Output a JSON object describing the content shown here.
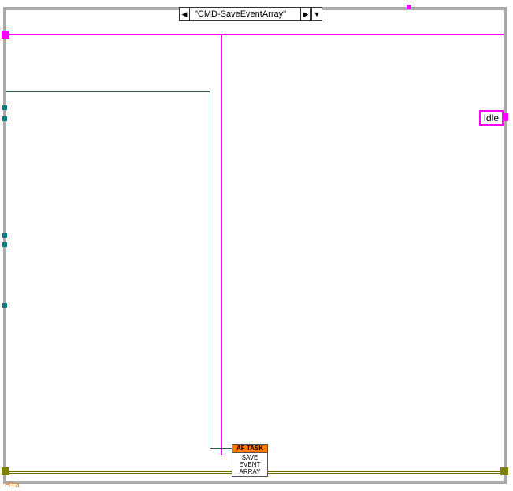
{
  "case": {
    "selector_text": "\"CMD-SaveEventArray\""
  },
  "enum": {
    "idle_label": "Idle"
  },
  "subvi": {
    "header": "AF TASK",
    "line1": "SAVE",
    "line2": "EVENT",
    "line3": "ARRAY"
  },
  "anno": {
    "bottom_left": "H=a"
  },
  "colors": {
    "magenta": "#ff00ff",
    "olive": "#808000",
    "green": "#3a5c47",
    "orange": "#ff7a00",
    "teal": "#008080"
  }
}
